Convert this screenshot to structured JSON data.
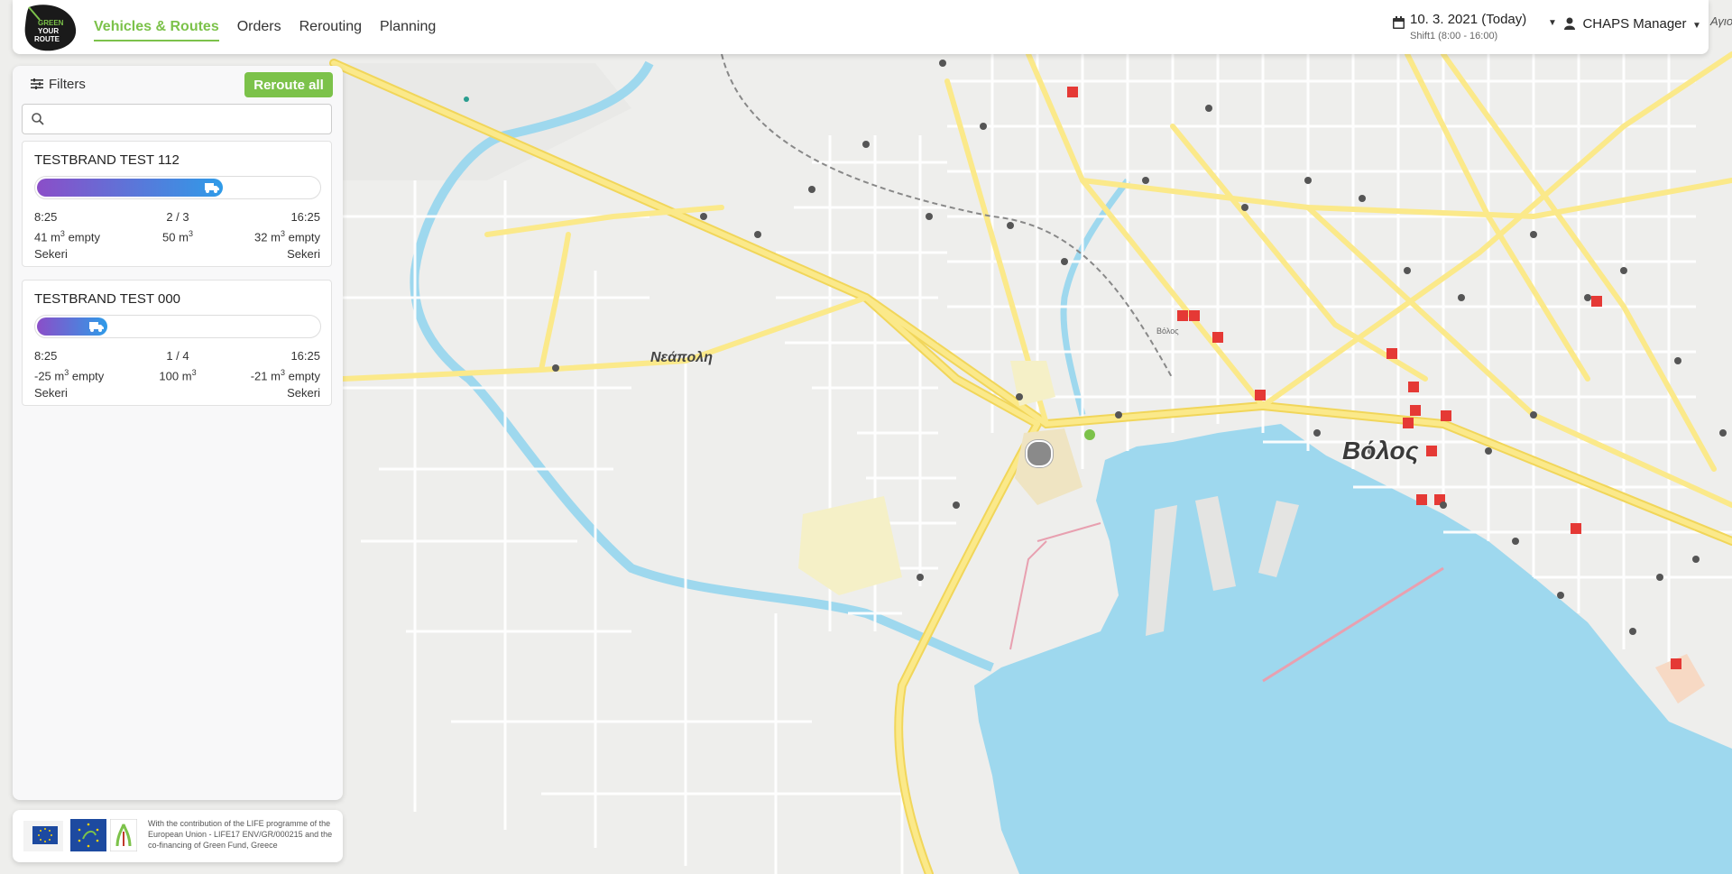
{
  "header": {
    "logo_text": "GREEN YOUR ROUTE",
    "nav": [
      {
        "label": "Vehicles & Routes",
        "active": true
      },
      {
        "label": "Orders",
        "active": false
      },
      {
        "label": "Rerouting",
        "active": false
      },
      {
        "label": "Planning",
        "active": false
      }
    ],
    "date_label": "10. 3. 2021 (Today)",
    "shift_label": "Shift1 (8:00 - 16:00)",
    "user_label": "CHAPS Manager",
    "accent_color": "#7cc24a"
  },
  "panel": {
    "filters_label": "Filters",
    "reroute_label": "Reroute all",
    "search_placeholder": "",
    "vehicles": [
      {
        "name": "TESTBRAND TEST 112",
        "progress": 0.66,
        "start_time": "8:25",
        "start_capacity": "41",
        "start_capacity_suffix": "empty",
        "start_place": "Sekeri",
        "stops": "2 / 3",
        "volume": "50",
        "end_time": "16:25",
        "end_capacity": "32",
        "end_capacity_suffix": "empty",
        "end_place": "Sekeri"
      },
      {
        "name": "TESTBRAND TEST 000",
        "progress": 0.25,
        "start_time": "8:25",
        "start_capacity": "-25",
        "start_capacity_suffix": "empty",
        "start_place": "Sekeri",
        "stops": "1 / 4",
        "volume": "100",
        "end_time": "16:25",
        "end_capacity": "-21",
        "end_capacity_suffix": "empty",
        "end_place": "Sekeri"
      }
    ]
  },
  "footer": {
    "text": "With the contribution of the LIFE programme of the European Union - LIFE17 ENV/GR/000215 and the co-financing of Green Fund, Greece"
  },
  "map": {
    "labels": {
      "neapoli": "Νεάπολη",
      "volos": "Βόλος",
      "volos_small": "Βόλος",
      "edge": "Αγιο"
    },
    "colors": {
      "water": "#9ed8ee",
      "main_road": "#fbe98a",
      "land": "#f2f2f0",
      "hospital": "#e53935"
    }
  }
}
